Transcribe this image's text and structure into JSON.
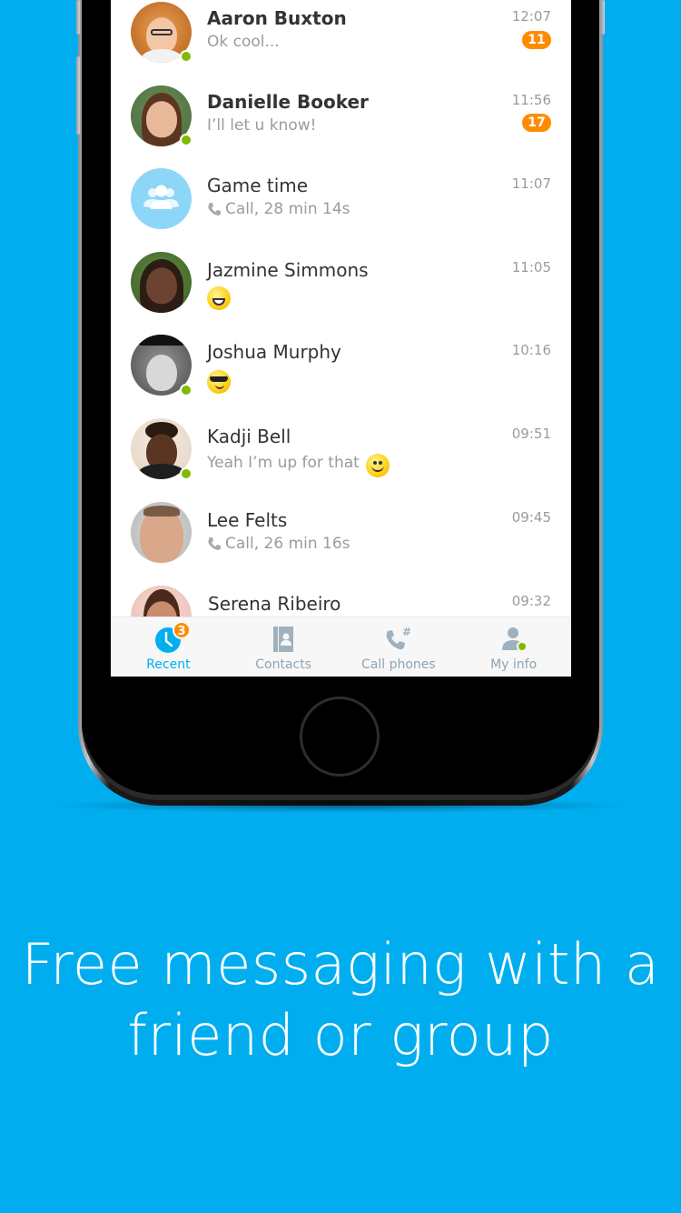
{
  "colors": {
    "background": "#00AEEF",
    "accent": "#00AFF0",
    "unread_badge": "#FF8C00",
    "presence_online": "#7FBA00",
    "group_avatar": "#8DD6F7"
  },
  "chats": [
    {
      "name": "Aaron Buxton",
      "preview": "Ok cool...",
      "time": "12:07",
      "unread": "11",
      "bold": true,
      "online": true,
      "avatar": "photo"
    },
    {
      "name": "Danielle Booker",
      "preview": "I’ll let u know!",
      "time": "11:56",
      "unread": "17",
      "bold": true,
      "online": true,
      "avatar": "photo"
    },
    {
      "name": "Game time",
      "preview": "Call, 28 min 14s",
      "preview_icon": "phone-icon",
      "time": "11:07",
      "online": false,
      "avatar": "group-icon"
    },
    {
      "name": "Jazmine Simmons",
      "preview_emoji": "laughing-emoji",
      "time": "11:05",
      "online": false,
      "avatar": "photo"
    },
    {
      "name": "Joshua Murphy",
      "preview_emoji": "cool-sunglasses-emoji",
      "time": "10:16",
      "online": true,
      "avatar": "photo"
    },
    {
      "name": "Kadji Bell",
      "preview": "Yeah I’m up for that",
      "preview_emoji": "smile-emoji",
      "time": "09:51",
      "online": true,
      "avatar": "photo"
    },
    {
      "name": "Lee Felts",
      "preview": "Call, 26 min 16s",
      "preview_icon": "phone-icon",
      "time": "09:45",
      "online": false,
      "avatar": "photo"
    },
    {
      "name": "Serena Ribeiro",
      "time": "09:32",
      "online": false,
      "avatar": "photo"
    }
  ],
  "tabs": [
    {
      "label": "Recent",
      "icon": "clock-icon",
      "active": true,
      "badge": "3"
    },
    {
      "label": "Contacts",
      "icon": "contacts-book-icon",
      "active": false
    },
    {
      "label": "Call phones",
      "icon": "dialpad-phone-icon",
      "active": false
    },
    {
      "label": "My info",
      "icon": "user-icon",
      "active": false,
      "online": true
    }
  ],
  "caption": {
    "line1": "Free messaging with a",
    "line2": "friend or group"
  }
}
